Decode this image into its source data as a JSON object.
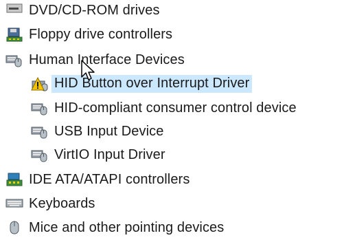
{
  "tree": {
    "items": [
      {
        "label": "DVD/CD-ROM drives",
        "icon": "dvd-drive-icon",
        "level": 0
      },
      {
        "label": "Floppy drive controllers",
        "icon": "floppy-controller-icon",
        "level": 0
      },
      {
        "label": "Human Interface Devices",
        "icon": "hid-icon",
        "level": 0
      },
      {
        "label": "HID Button over Interrupt Driver",
        "icon": "warning-device-icon",
        "level": 1,
        "selected": true
      },
      {
        "label": "HID-compliant consumer control device",
        "icon": "hid-device-icon",
        "level": 1
      },
      {
        "label": "USB Input Device",
        "icon": "hid-device-icon",
        "level": 1
      },
      {
        "label": "VirtIO Input Driver",
        "icon": "hid-device-icon",
        "level": 1
      },
      {
        "label": "IDE ATA/ATAPI controllers",
        "icon": "ide-controller-icon",
        "level": 0
      },
      {
        "label": "Keyboards",
        "icon": "keyboard-icon",
        "level": 0
      },
      {
        "label": "Mice and other pointing devices",
        "icon": "mouse-icon",
        "level": 0
      }
    ]
  },
  "colors": {
    "selection": "#cce8ff",
    "warning": "#f5c400"
  }
}
